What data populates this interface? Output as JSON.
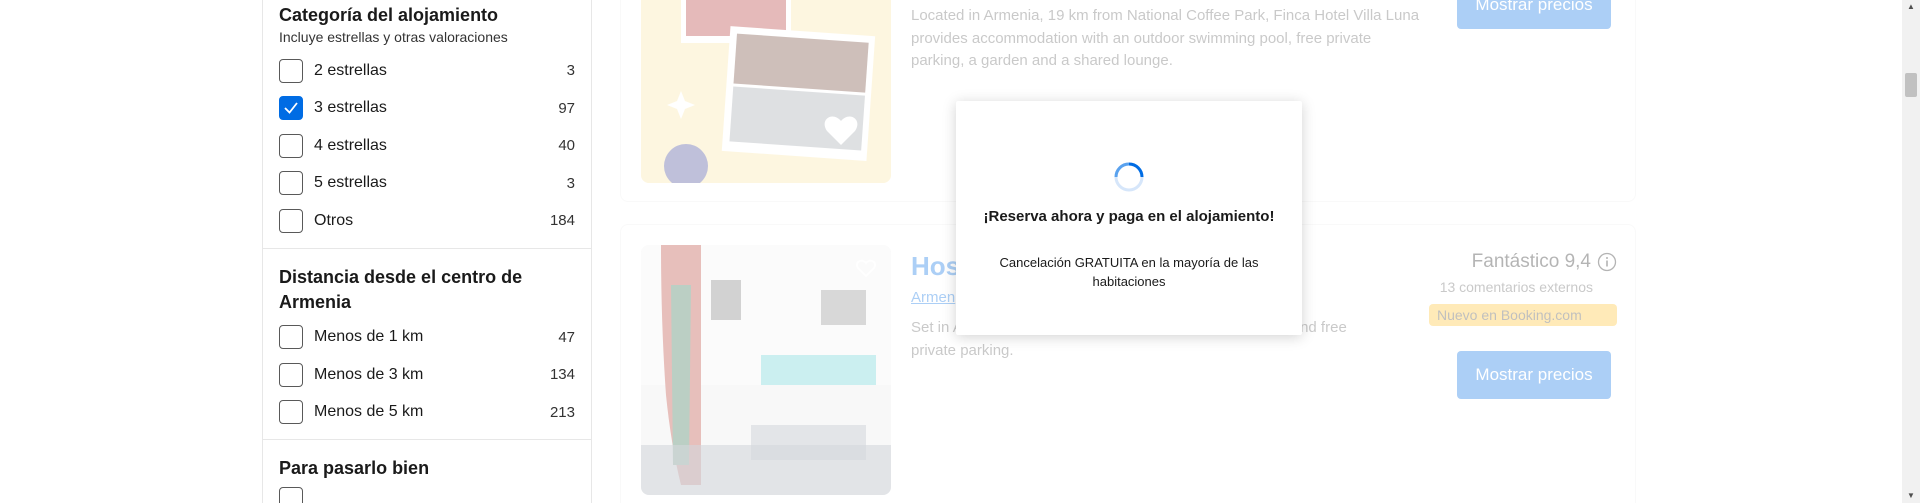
{
  "sidebar": {
    "category": {
      "title": "Categoría del alojamiento",
      "subtitle": "Incluye estrellas y otras valoraciones",
      "options": [
        {
          "label": "2 estrellas",
          "count": "3",
          "checked": false
        },
        {
          "label": "3 estrellas",
          "count": "97",
          "checked": true
        },
        {
          "label": "4 estrellas",
          "count": "40",
          "checked": false
        },
        {
          "label": "5 estrellas",
          "count": "3",
          "checked": false
        },
        {
          "label": "Otros",
          "count": "184",
          "checked": false
        }
      ]
    },
    "distance": {
      "title": "Distancia desde el centro de Armenia",
      "options": [
        {
          "label": "Menos de 1 km",
          "count": "47",
          "checked": false
        },
        {
          "label": "Menos de 3 km",
          "count": "134",
          "checked": false
        },
        {
          "label": "Menos de 5 km",
          "count": "213",
          "checked": false
        }
      ]
    },
    "fun": {
      "title": "Para pasarlo bien"
    }
  },
  "results": {
    "card1": {
      "description": "Located in Armenia, 19 km from National Coffee Park, Finca Hotel Villa Luna provides accommodation with an outdoor swimming pool, free private parking, a garden and a shared lounge.",
      "button": "Mostrar precios"
    },
    "card2": {
      "title_fragment": "Hos",
      "location_fragment": "Armen",
      "description": "Set in A                                                              sa granada offers accommodation with free WiFi and free private parking.",
      "rating": "Fantástico 9,4",
      "reviews": "13 comentarios externos",
      "badge": "Nuevo en Booking.com",
      "button": "Mostrar precios"
    }
  },
  "modal": {
    "title": "¡Reserva ahora y paga en el alojamiento!",
    "subtitle": "Cancelación GRATUITA en la mayoría de las habitaciones"
  },
  "colors": {
    "accent": "#006ce4",
    "badge": "#ffb700"
  }
}
